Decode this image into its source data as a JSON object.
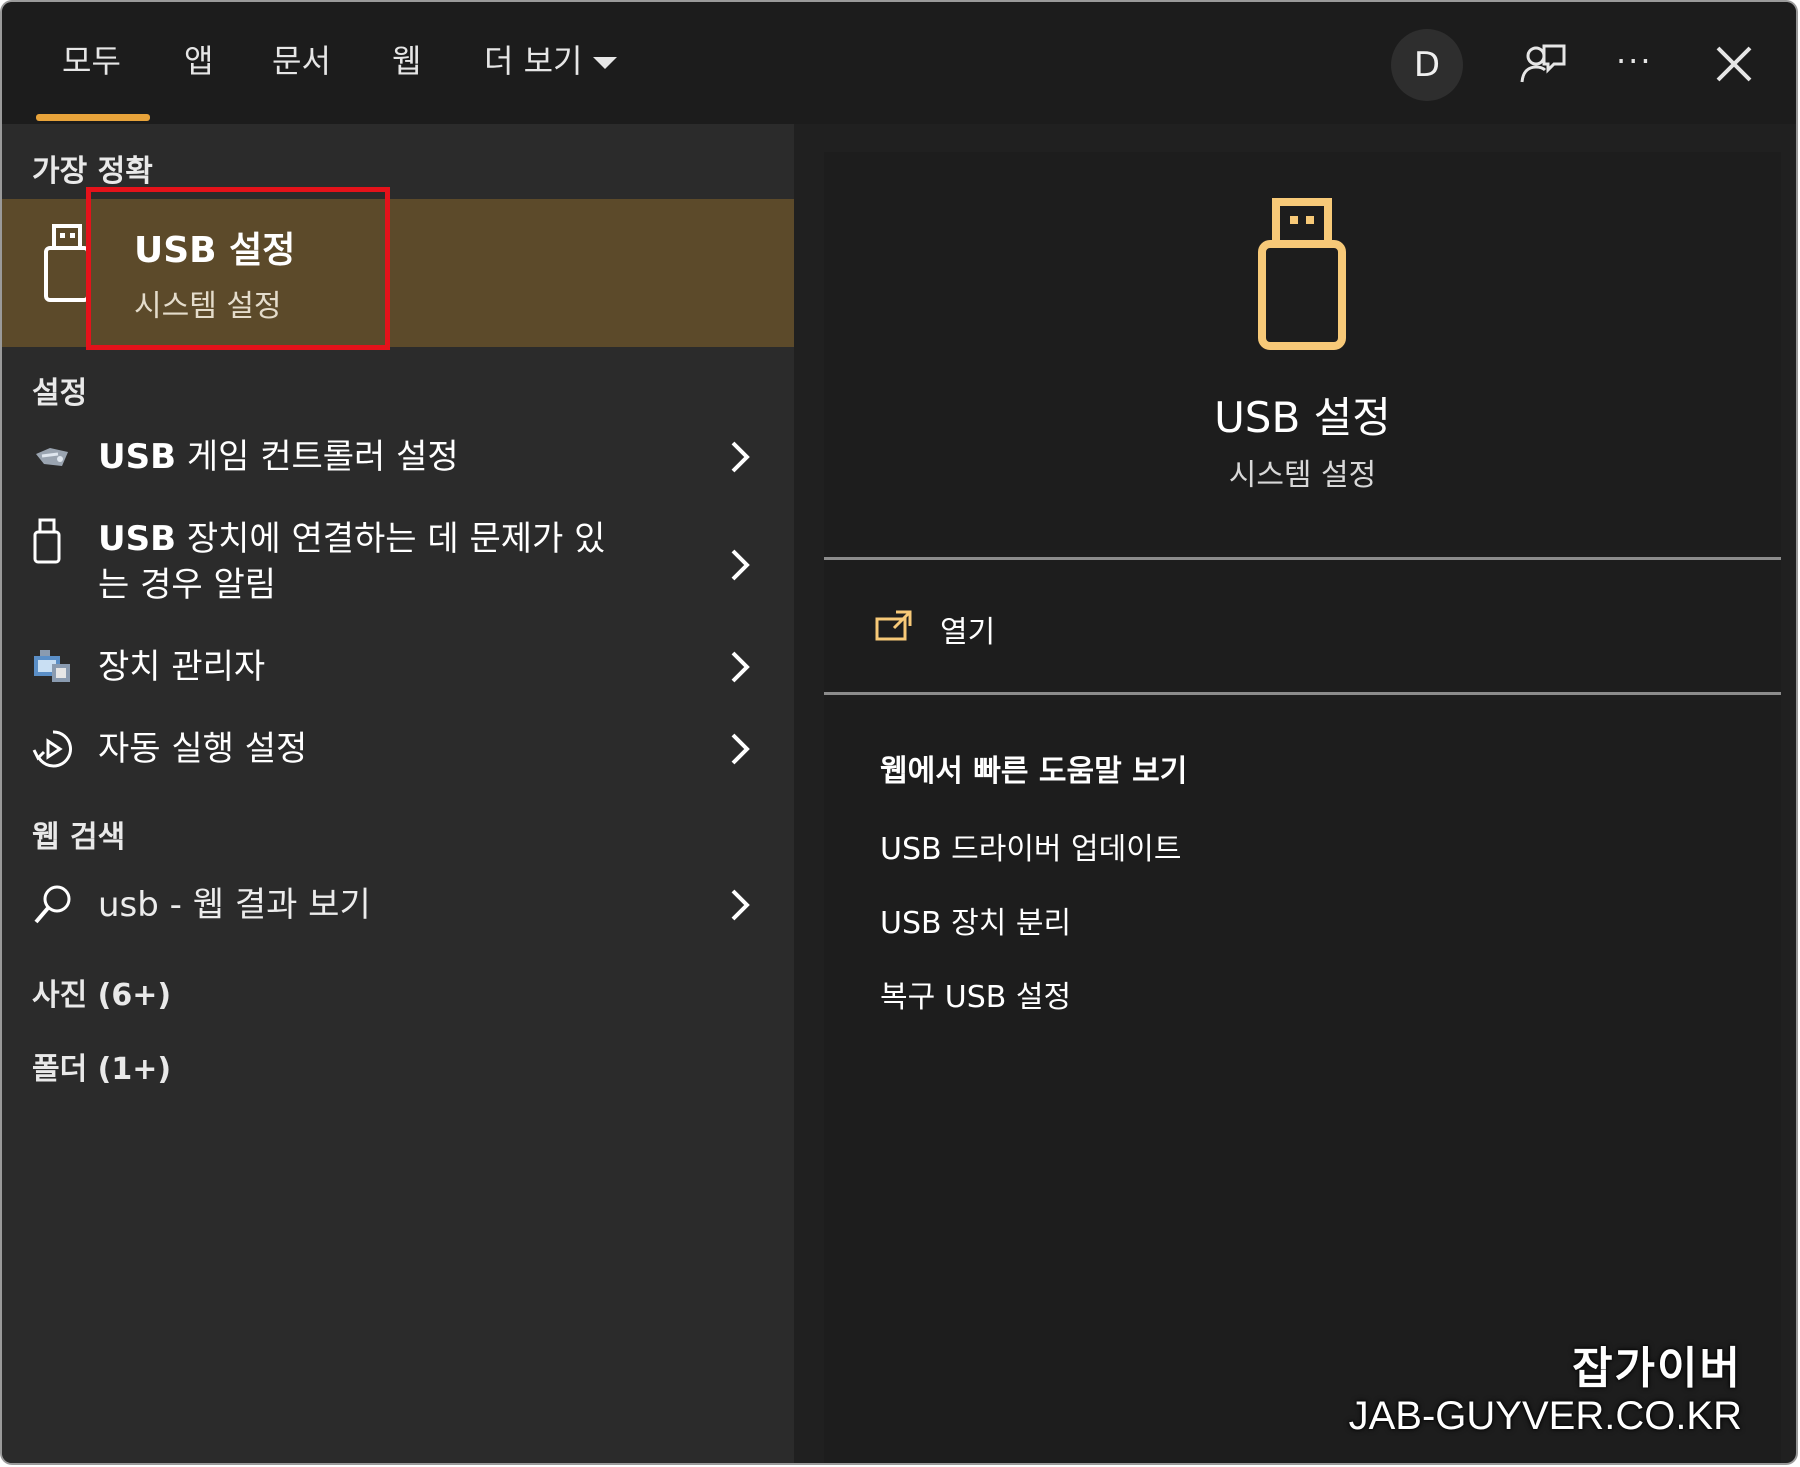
{
  "tabs": [
    {
      "label": "모두",
      "active": true
    },
    {
      "label": "앱"
    },
    {
      "label": "문서"
    },
    {
      "label": "웹"
    },
    {
      "label": "더 보기"
    }
  ],
  "header": {
    "avatar_letter": "D",
    "accent_color": "#e8a33a",
    "icons": [
      "feedback-icon",
      "more-icon",
      "close-icon"
    ],
    "more_label": "···"
  },
  "left": {
    "best_match_heading": "가장 정확",
    "best_match": {
      "title": "USB 설정",
      "subtitle": "시스템 설정",
      "icon": "usb-drive-icon",
      "highlight_color": "#5c4a2a"
    },
    "settings_heading": "설정",
    "settings_items": [
      {
        "label_bold": "USB",
        "label_rest": " 게임 컨트롤러 설정",
        "icon": "game-controller-icon"
      },
      {
        "label_bold": "USB",
        "label_rest": " 장치에 연결하는 데 문제가 있",
        "label_line2": "는 경우 알림",
        "icon": "usb-drive-icon"
      },
      {
        "label": "장치 관리자",
        "icon": "device-manager-icon"
      },
      {
        "label": "자동 실행 설정",
        "icon": "autoplay-icon"
      }
    ],
    "web_heading": "웹 검색",
    "web_item": {
      "label": "usb - 웹 결과 보기",
      "icon": "search-icon"
    },
    "photos_heading": "사진 (6+)",
    "folders_heading": "폴더 (1+)"
  },
  "right": {
    "preview_title": "USB 설정",
    "preview_subtitle": "시스템 설정",
    "open_label": "열기",
    "help_heading": "웹에서 빠른 도움말 보기",
    "help_links": [
      "USB 드라이버 업데이트",
      "USB 장치 분리",
      "복구 USB 설정"
    ]
  },
  "watermark": {
    "line1": "잡가이버",
    "line2": "JAB-GUYVER.CO.KR"
  }
}
